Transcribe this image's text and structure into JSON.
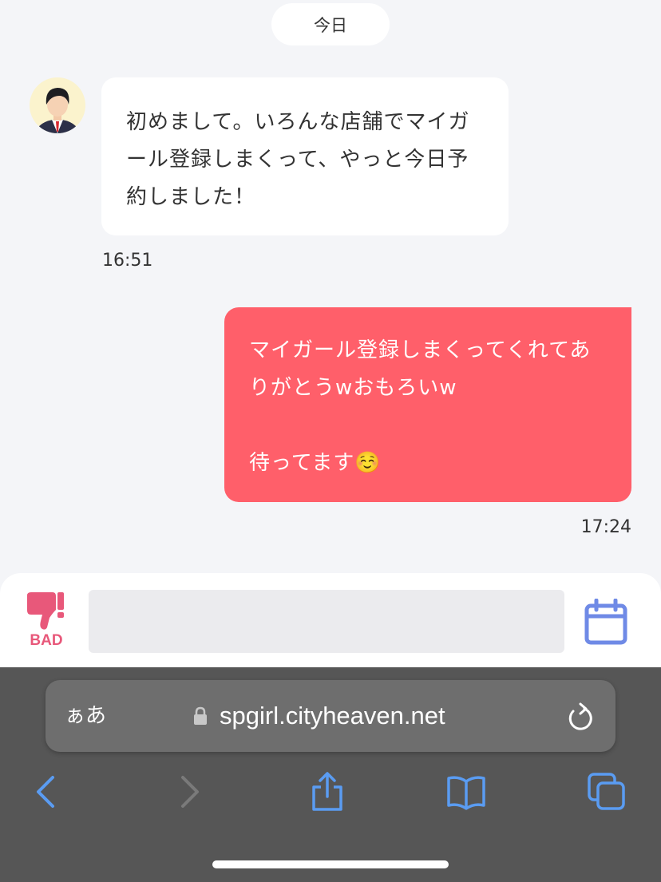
{
  "date_separator": "今日",
  "messages": {
    "incoming": {
      "text": "初めまして。いろんな店舗でマイガール登録しまくって、やっと今日予約しました！",
      "time": "16:51"
    },
    "outgoing": {
      "line1": "マイガール登録しまくってくれてありがとうwおもろいw",
      "line2": "待ってます☺️",
      "time": "17:24",
      "bubble_color": "#ff5f6a"
    }
  },
  "input_bar": {
    "bad_label": "BAD",
    "bad_color": "#e8587a",
    "calendar_color": "#6f8ae6"
  },
  "browser": {
    "aa_label": "ぁあ",
    "url": "spgirl.cityheaven.net",
    "icon_color": "#5a9cf2"
  }
}
